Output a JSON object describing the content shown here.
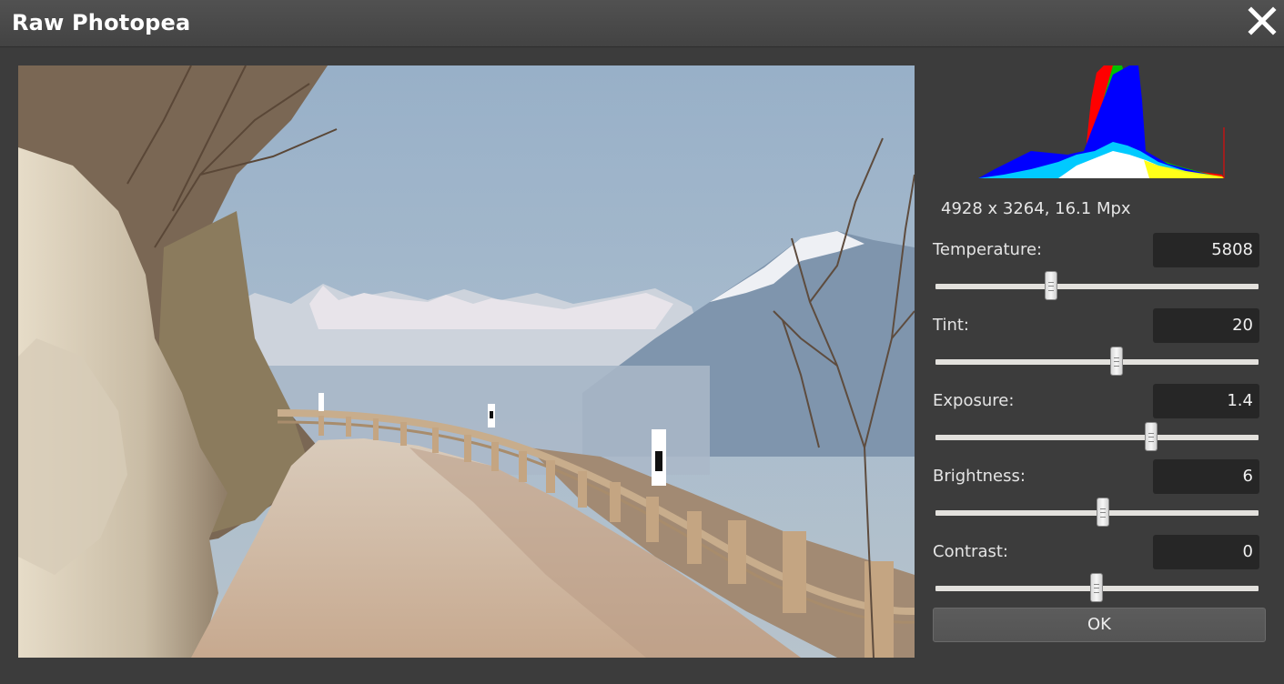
{
  "window": {
    "title": "Raw Photopea"
  },
  "image_info": "4928 x 3264, 16.1 Mpx",
  "controls": [
    {
      "label": "Temperature:",
      "value": "5808",
      "slider_fraction": 0.357
    },
    {
      "label": "Tint:",
      "value": "20",
      "slider_fraction": 0.561
    },
    {
      "label": "Exposure:",
      "value": "1.4",
      "slider_fraction": 0.668
    },
    {
      "label": "Brightness:",
      "value": "6",
      "slider_fraction": 0.518
    },
    {
      "label": "Contrast:",
      "value": "0",
      "slider_fraction": 0.499
    }
  ],
  "ok_label": "OK",
  "icons": {
    "close": "close-icon"
  }
}
